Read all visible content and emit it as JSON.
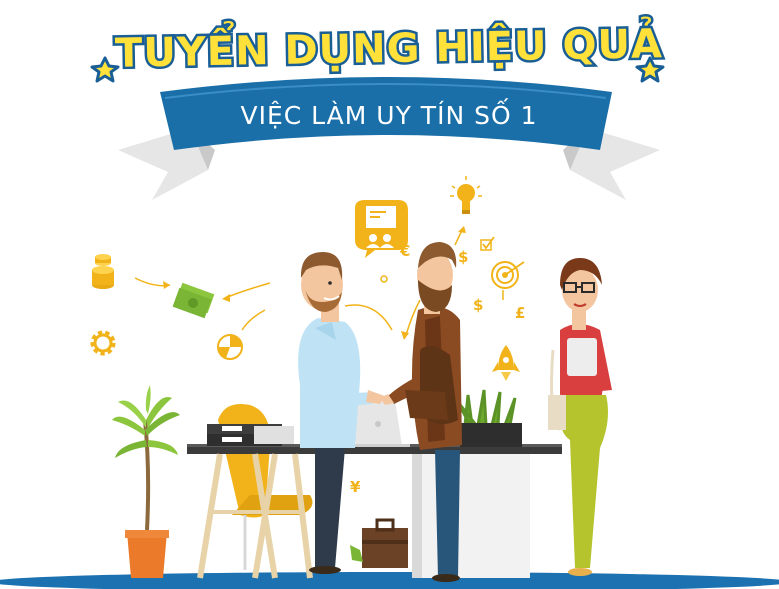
{
  "headline": {
    "title": "TUYỂN DỤNG HIỆU QUẢ",
    "subtitle": "VIỆC LÀM UY TÍN SỐ 1"
  },
  "colors": {
    "title_fill": "#FFE13A",
    "title_outline": "#1A5E96",
    "banner_blue": "#1A6FA8",
    "ribbon_gray": "#E4E4E4",
    "accent_yellow": "#F1B319",
    "floor_blue": "#1C72B0"
  },
  "decorations": {
    "currency_symbols": [
      "$",
      "€",
      "£",
      "$",
      "¥"
    ]
  },
  "icons": [
    "star-icon",
    "coins-icon",
    "money-icon",
    "gear-icon",
    "pie-chart-icon",
    "presentation-icon",
    "lightbulb-icon",
    "checkbox-icon",
    "target-icon",
    "rocket-icon"
  ]
}
